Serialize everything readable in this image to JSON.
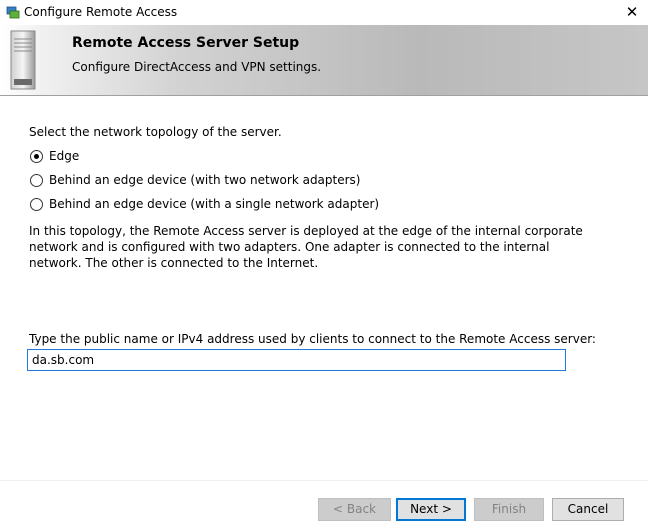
{
  "window": {
    "title": "Configure Remote Access",
    "close_glyph": "✕"
  },
  "banner": {
    "title": "Remote Access Server Setup",
    "subtitle": "Configure DirectAccess and VPN settings."
  },
  "topology": {
    "prompt": "Select the network topology of the server.",
    "options": [
      {
        "label": "Edge",
        "selected": true
      },
      {
        "label": "Behind an edge device (with two network adapters)",
        "selected": false
      },
      {
        "label": "Behind an edge device (with a single network adapter)",
        "selected": false
      }
    ],
    "description": "In this topology, the Remote Access server is deployed at the edge of the internal corporate network and is configured with two adapters. One adapter is connected to the internal network. The other is connected to the Internet."
  },
  "public_name": {
    "label": "Type the public name or IPv4 address used by clients to connect to the Remote Access server:",
    "value": "da.sb.com"
  },
  "buttons": {
    "back": "< Back",
    "next": "Next >",
    "finish": "Finish",
    "cancel": "Cancel"
  },
  "colors": {
    "accent": "#0078d7"
  },
  "icons": {
    "app": "remote-access-icon",
    "banner": "server-icon",
    "close": "close-icon"
  }
}
